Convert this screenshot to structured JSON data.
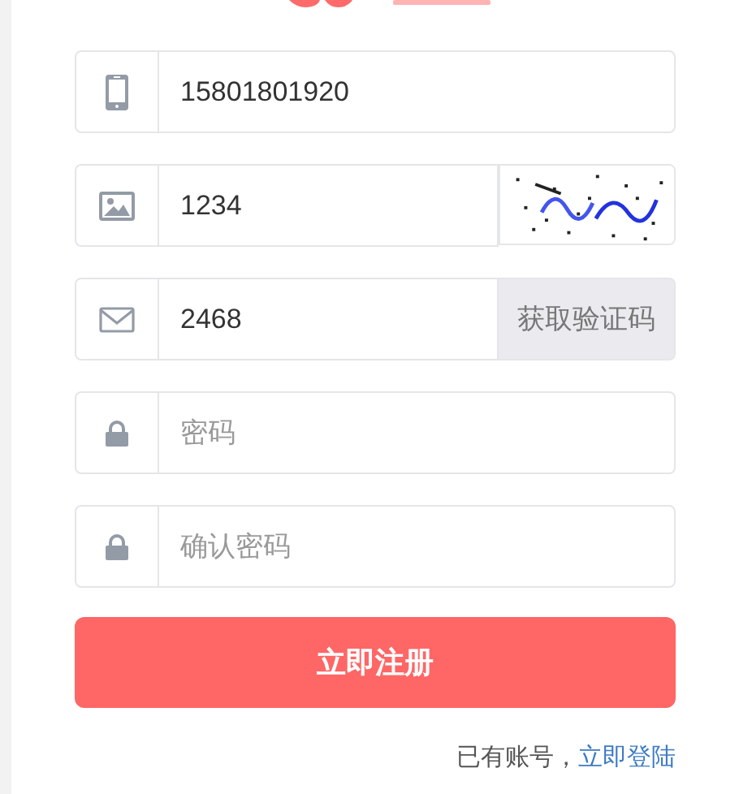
{
  "form": {
    "fields": [
      {
        "kind": "phone",
        "value": "15801801920"
      },
      {
        "kind": "captcha",
        "value": "1234"
      },
      {
        "kind": "code",
        "value": "2468",
        "addon": {
          "kind": "button",
          "label": "获取验证码"
        }
      },
      {
        "kind": "password",
        "placeholder": "密码"
      },
      {
        "kind": "password",
        "placeholder": "确认密码"
      }
    ],
    "submit": "立即注册",
    "footer": {
      "text": "已有账号，",
      "link": "立即登陆"
    }
  }
}
